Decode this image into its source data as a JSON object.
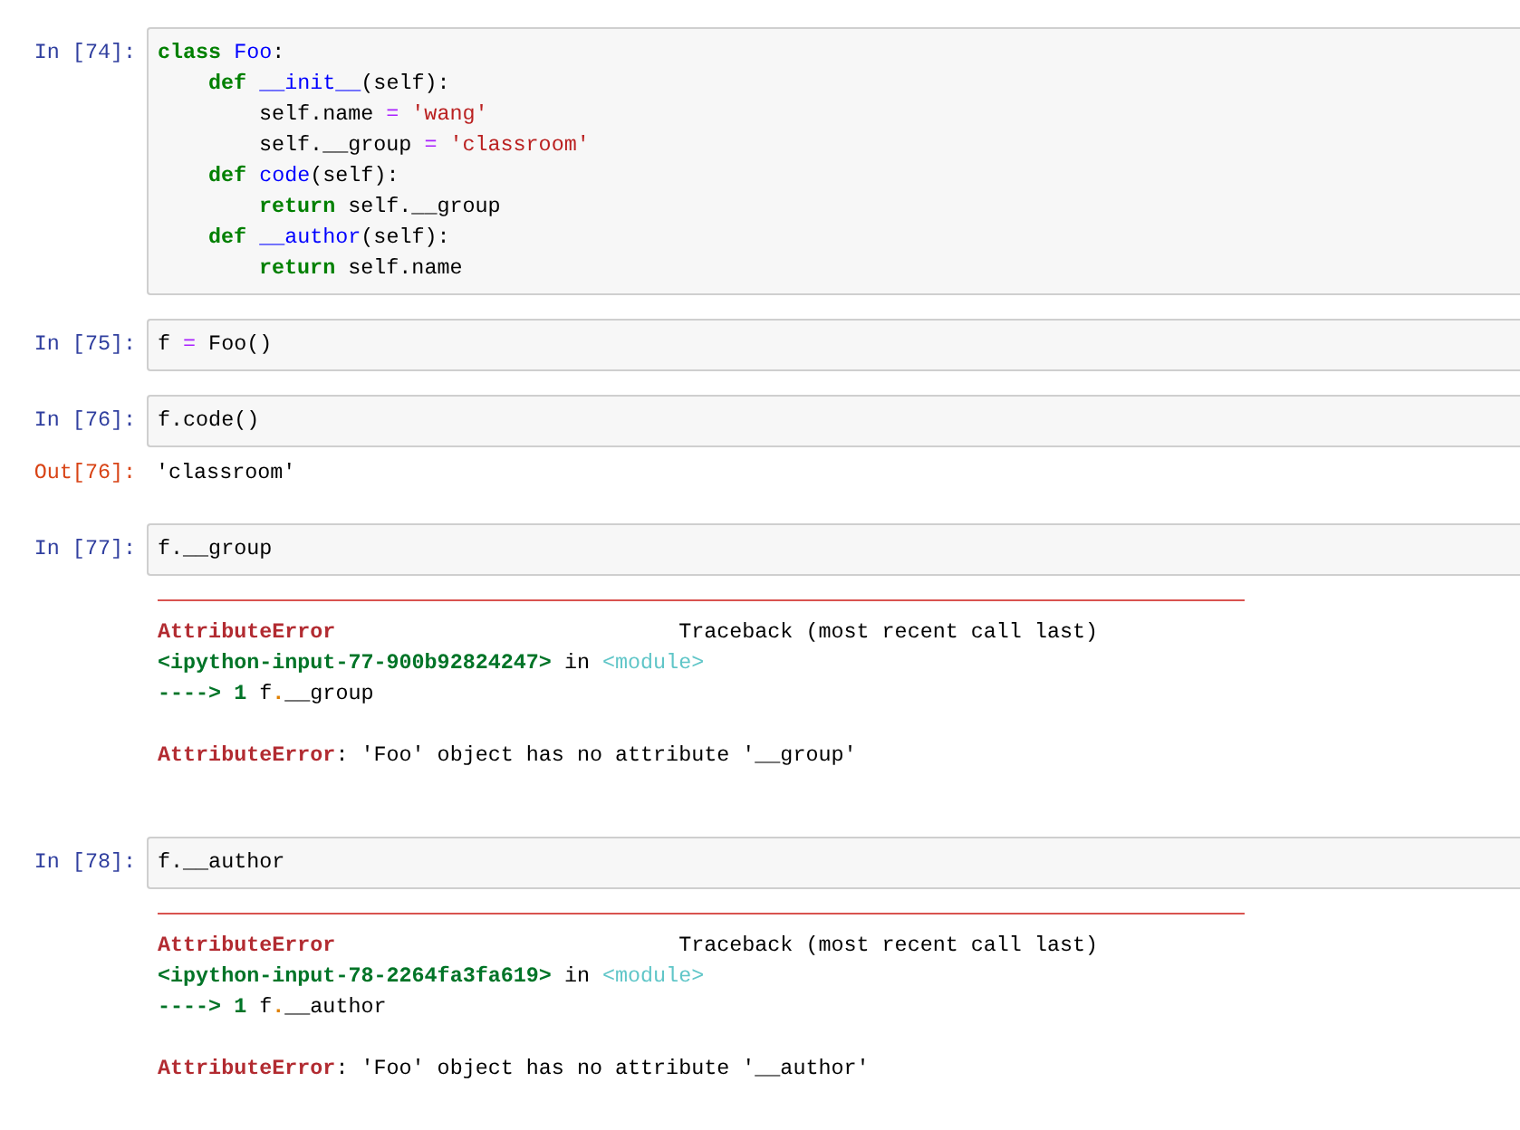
{
  "cells": [
    {
      "prompt": "In [74]:",
      "code": [
        {
          "tokens": [
            {
              "kind": "kw",
              "t": "class "
            },
            {
              "kind": "name",
              "t": "Foo"
            },
            {
              "kind": "plain",
              "t": ":"
            }
          ],
          "children": [
            {
              "tokens": [
                {
                  "kind": "kw",
                  "t": "def "
                },
                {
                  "kind": "name",
                  "t": "__init__"
                },
                {
                  "kind": "plain",
                  "t": "(self):"
                }
              ],
              "children": [
                {
                  "tokens": [
                    {
                      "kind": "plain",
                      "t": "self.name "
                    },
                    {
                      "kind": "op",
                      "t": "="
                    },
                    {
                      "kind": "str",
                      "t": " 'wang'"
                    }
                  ]
                },
                {
                  "tokens": [
                    {
                      "kind": "plain",
                      "t": "self.__group "
                    },
                    {
                      "kind": "op",
                      "t": "="
                    },
                    {
                      "kind": "str",
                      "t": " 'classroom'"
                    }
                  ]
                }
              ]
            },
            {
              "tokens": [
                {
                  "kind": "kw",
                  "t": "def "
                },
                {
                  "kind": "name",
                  "t": "code"
                },
                {
                  "kind": "plain",
                  "t": "(self):"
                }
              ],
              "children": [
                {
                  "tokens": [
                    {
                      "kind": "kw",
                      "t": "return "
                    },
                    {
                      "kind": "plain",
                      "t": "self.__group"
                    }
                  ]
                }
              ]
            },
            {
              "tokens": [
                {
                  "kind": "kw",
                  "t": "def "
                },
                {
                  "kind": "name",
                  "t": "__author"
                },
                {
                  "kind": "plain",
                  "t": "(self):"
                }
              ],
              "children": [
                {
                  "tokens": [
                    {
                      "kind": "kw",
                      "t": "return "
                    },
                    {
                      "kind": "plain",
                      "t": "self.name"
                    }
                  ]
                }
              ]
            }
          ]
        }
      ]
    },
    {
      "prompt": "In [75]:",
      "code": [
        {
          "tokens": [
            {
              "kind": "plain",
              "t": "f "
            },
            {
              "kind": "op",
              "t": "="
            },
            {
              "kind": "plain",
              "t": " Foo"
            },
            {
              "kind": "paren",
              "t": "()"
            }
          ]
        }
      ]
    },
    {
      "prompt": "In [76]:",
      "code": [
        {
          "tokens": [
            {
              "kind": "plain",
              "t": "f.code"
            },
            {
              "kind": "paren",
              "t": "()"
            }
          ]
        }
      ],
      "output": {
        "kind": "result",
        "prompt": "Out[76]:",
        "text": "'classroom'"
      }
    },
    {
      "prompt": "In [77]:",
      "code": [
        {
          "tokens": [
            {
              "kind": "plain",
              "t": "f.__group"
            }
          ]
        }
      ],
      "output": {
        "kind": "error",
        "traceback": [
          [
            {
              "kind": "ename",
              "t": "AttributeError"
            },
            {
              "kind": "plain",
              "t": "                           Traceback (most recent call last)"
            }
          ],
          [
            {
              "kind": "file",
              "t": "<ipython-input-77-900b92824247>"
            },
            {
              "kind": "plain",
              "t": " in "
            },
            {
              "kind": "module",
              "t": "<module>"
            }
          ],
          [
            {
              "kind": "arrow",
              "t": "----> 1 "
            },
            {
              "kind": "plain",
              "t": "f"
            },
            {
              "kind": "dot",
              "t": "."
            },
            {
              "kind": "plain",
              "t": "__group"
            }
          ]
        ],
        "message": [
          {
            "kind": "ename",
            "t": "AttributeError"
          },
          {
            "kind": "plain",
            "t": ": 'Foo' object has no attribute '__group'"
          }
        ]
      }
    },
    {
      "prompt": "In [78]:",
      "code": [
        {
          "tokens": [
            {
              "kind": "plain",
              "t": "f.__author"
            }
          ]
        }
      ],
      "output": {
        "kind": "error",
        "traceback": [
          [
            {
              "kind": "ename",
              "t": "AttributeError"
            },
            {
              "kind": "plain",
              "t": "                           Traceback (most recent call last)"
            }
          ],
          [
            {
              "kind": "file",
              "t": "<ipython-input-78-2264fa3fa619>"
            },
            {
              "kind": "plain",
              "t": " in "
            },
            {
              "kind": "module",
              "t": "<module>"
            }
          ],
          [
            {
              "kind": "arrow",
              "t": "----> 1 "
            },
            {
              "kind": "plain",
              "t": "f"
            },
            {
              "kind": "dot",
              "t": "."
            },
            {
              "kind": "plain",
              "t": "__author"
            }
          ]
        ],
        "message": [
          {
            "kind": "ename",
            "t": "AttributeError"
          },
          {
            "kind": "plain",
            "t": ": 'Foo' object has no attribute '__author'"
          }
        ]
      }
    }
  ]
}
